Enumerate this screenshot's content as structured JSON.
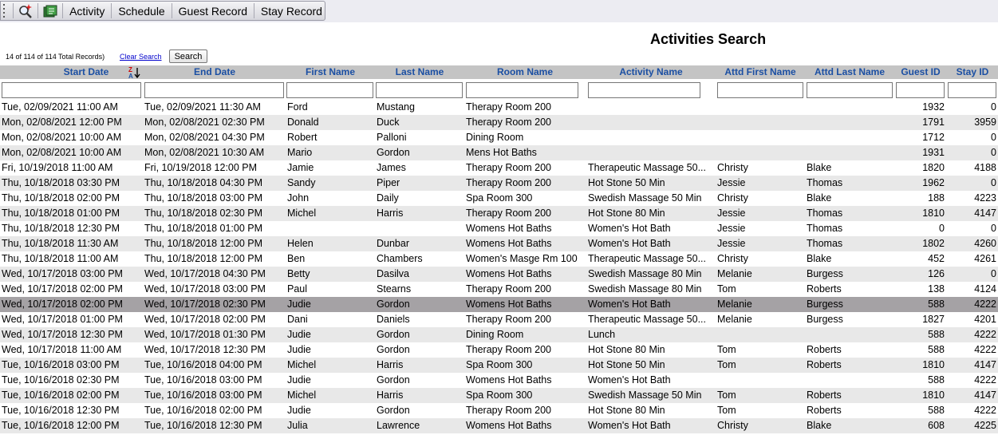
{
  "toolbar": {
    "icons": [
      "search-refresh-icon",
      "report-icon"
    ],
    "buttons": [
      "Activity",
      "Schedule",
      "Guest Record",
      "Stay Record"
    ]
  },
  "page": {
    "title": "Activities Search",
    "record_info": "14 of 114 of 114 Total Records)",
    "clear_search": "Clear Search",
    "search_button": "Search"
  },
  "columns": [
    "Start Date",
    "End Date",
    "First Name",
    "Last Name",
    "Room Name",
    "Activity Name",
    "Attd First Name",
    "Attd Last Name",
    "Guest ID",
    "Stay ID"
  ],
  "sort_indicator": {
    "top": "Z",
    "bottom": "A"
  },
  "selected_row": 13,
  "rows": [
    [
      "Tue, 02/09/2021 11:00 AM",
      "Tue, 02/09/2021 11:30 AM",
      "Ford",
      "Mustang",
      "Therapy Room 200",
      "",
      "",
      "",
      "1932",
      "0"
    ],
    [
      "Mon, 02/08/2021 12:00 PM",
      "Mon, 02/08/2021 02:30 PM",
      "Donald",
      "Duck",
      "Therapy Room 200",
      "",
      "",
      "",
      "1791",
      "3959"
    ],
    [
      "Mon, 02/08/2021 10:00 AM",
      "Mon, 02/08/2021 04:30 PM",
      "Robert",
      "Palloni",
      "Dining Room",
      "",
      "",
      "",
      "1712",
      "0"
    ],
    [
      "Mon, 02/08/2021 10:00 AM",
      "Mon, 02/08/2021 10:30 AM",
      "Mario",
      "Gordon",
      "Mens Hot Baths",
      "",
      "",
      "",
      "1931",
      "0"
    ],
    [
      "Fri, 10/19/2018 11:00 AM",
      "Fri, 10/19/2018 12:00 PM",
      "Jamie",
      "James",
      "Therapy Room 200",
      "Therapeutic Massage 50...",
      "Christy",
      "Blake",
      "1820",
      "4188"
    ],
    [
      "Thu, 10/18/2018 03:30 PM",
      "Thu, 10/18/2018 04:30 PM",
      "Sandy",
      "Piper",
      "Therapy Room 200",
      "Hot Stone 50 Min",
      "Jessie",
      "Thomas",
      "1962",
      "0"
    ],
    [
      "Thu, 10/18/2018 02:00 PM",
      "Thu, 10/18/2018 03:00 PM",
      "John",
      "Daily",
      "Spa Room 300",
      "Swedish Massage 50 Min",
      "Christy",
      "Blake",
      "188",
      "4223"
    ],
    [
      "Thu, 10/18/2018 01:00 PM",
      "Thu, 10/18/2018 02:30 PM",
      "Michel",
      "Harris",
      "Therapy Room 200",
      "Hot Stone 80 Min",
      "Jessie",
      "Thomas",
      "1810",
      "4147"
    ],
    [
      "Thu, 10/18/2018 12:30 PM",
      "Thu, 10/18/2018 01:00 PM",
      "",
      "",
      "Womens Hot Baths",
      "Women's Hot Bath",
      "Jessie",
      "Thomas",
      "0",
      "0"
    ],
    [
      "Thu, 10/18/2018 11:30 AM",
      "Thu, 10/18/2018 12:00 PM",
      "Helen",
      "Dunbar",
      "Womens Hot Baths",
      "Women's Hot Bath",
      "Jessie",
      "Thomas",
      "1802",
      "4260"
    ],
    [
      "Thu, 10/18/2018 11:00 AM",
      "Thu, 10/18/2018 12:00 PM",
      "Ben",
      "Chambers",
      "Women's Masge Rm 100",
      "Therapeutic Massage 50...",
      "Christy",
      "Blake",
      "452",
      "4261"
    ],
    [
      "Wed, 10/17/2018 03:00 PM",
      "Wed, 10/17/2018 04:30 PM",
      "Betty",
      "Dasilva",
      "Womens Hot Baths",
      "Swedish Massage 80 Min",
      "Melanie",
      "Burgess",
      "126",
      "0"
    ],
    [
      "Wed, 10/17/2018 02:00 PM",
      "Wed, 10/17/2018 03:00 PM",
      "Paul",
      "Stearns",
      "Therapy Room 200",
      "Swedish Massage 80 Min",
      "Tom",
      "Roberts",
      "138",
      "4124"
    ],
    [
      "Wed, 10/17/2018 02:00 PM",
      "Wed, 10/17/2018 02:30 PM",
      "Judie",
      "Gordon",
      "Womens Hot Baths",
      "Women's Hot Bath",
      "Melanie",
      "Burgess",
      "588",
      "4222"
    ],
    [
      "Wed, 10/17/2018 01:00 PM",
      "Wed, 10/17/2018 02:00 PM",
      "Dani",
      "Daniels",
      "Therapy Room 200",
      "Therapeutic Massage 50...",
      "Melanie",
      "Burgess",
      "1827",
      "4201"
    ],
    [
      "Wed, 10/17/2018 12:30 PM",
      "Wed, 10/17/2018 01:30 PM",
      "Judie",
      "Gordon",
      "Dining Room",
      "Lunch",
      "",
      "",
      "588",
      "4222"
    ],
    [
      "Wed, 10/17/2018 11:00 AM",
      "Wed, 10/17/2018 12:30 PM",
      "Judie",
      "Gordon",
      "Therapy Room 200",
      "Hot Stone 80 Min",
      "Tom",
      "Roberts",
      "588",
      "4222"
    ],
    [
      "Tue, 10/16/2018 03:00 PM",
      "Tue, 10/16/2018 04:00 PM",
      "Michel",
      "Harris",
      "Spa Room 300",
      "Hot Stone 50 Min",
      "Tom",
      "Roberts",
      "1810",
      "4147"
    ],
    [
      "Tue, 10/16/2018 02:30 PM",
      "Tue, 10/16/2018 03:00 PM",
      "Judie",
      "Gordon",
      "Womens Hot Baths",
      "Women's Hot Bath",
      "",
      "",
      "588",
      "4222"
    ],
    [
      "Tue, 10/16/2018 02:00 PM",
      "Tue, 10/16/2018 03:00 PM",
      "Michel",
      "Harris",
      "Spa Room 300",
      "Swedish Massage 50 Min",
      "Tom",
      "Roberts",
      "1810",
      "4147"
    ],
    [
      "Tue, 10/16/2018 12:30 PM",
      "Tue, 10/16/2018 02:00 PM",
      "Judie",
      "Gordon",
      "Therapy Room 200",
      "Hot Stone 80 Min",
      "Tom",
      "Roberts",
      "588",
      "4222"
    ],
    [
      "Tue, 10/16/2018 12:00 PM",
      "Tue, 10/16/2018 12:30 PM",
      "Julia",
      "Lawrence",
      "Womens Hot Baths",
      "Women's Hot Bath",
      "Christy",
      "Blake",
      "608",
      "4225"
    ]
  ]
}
